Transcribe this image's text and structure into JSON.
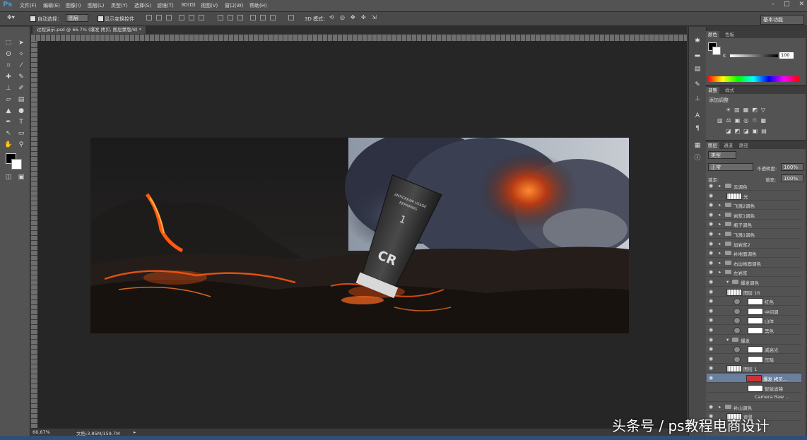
{
  "app": {
    "logo": "Ps"
  },
  "menu": [
    "文件(F)",
    "编辑(E)",
    "图像(I)",
    "图层(L)",
    "类型(Y)",
    "选择(S)",
    "滤镜(T)",
    "3D(D)",
    "视图(V)",
    "窗口(W)",
    "帮助(H)"
  ],
  "options": {
    "auto_select_label": "自动选择：",
    "auto_select_value": "图层",
    "show_transform_label": "显示变换控件",
    "mode_3d_label": "3D 模式："
  },
  "workspace": "基本功能",
  "document": {
    "tab_title": "过程演示.psd @ 66.7% (爆发 拷贝, 图层蒙版/8) *",
    "zoom": "66.67%",
    "doc_size": "文档:3.85M/159.7M"
  },
  "color_panel": {
    "tabs": [
      "颜色",
      "色板"
    ],
    "channel": "K",
    "value": "100"
  },
  "adjust_panel": {
    "tabs": [
      "调整",
      "样式"
    ],
    "title": "添加调整"
  },
  "layers_panel": {
    "tabs": [
      "图层",
      "通道",
      "路径"
    ],
    "filter": "类型",
    "blend_mode": "正常",
    "opacity_label": "不透明度:",
    "opacity": "100%",
    "lock_label": "锁定:",
    "fill_label": "填充:",
    "fill": "100%",
    "layers": [
      {
        "name": "云调色",
        "kind": "group"
      },
      {
        "name": "光",
        "kind": "layer"
      },
      {
        "name": "飞溅2调色",
        "kind": "group"
      },
      {
        "name": "岩浆1调色",
        "kind": "group"
      },
      {
        "name": "瓶子调色",
        "kind": "group"
      },
      {
        "name": "飞溅1调色",
        "kind": "group"
      },
      {
        "name": "加岩浆2",
        "kind": "group"
      },
      {
        "name": "补地面调色",
        "kind": "group"
      },
      {
        "name": "右边地面调色",
        "kind": "group"
      },
      {
        "name": "左岩浆",
        "kind": "group"
      },
      {
        "name": "爆发调色",
        "kind": "group-open"
      },
      {
        "name": "图层 16",
        "kind": "layer"
      },
      {
        "name": "红色",
        "kind": "adjust"
      },
      {
        "name": "中间调",
        "kind": "adjust"
      },
      {
        "name": "山体",
        "kind": "adjust"
      },
      {
        "name": "黑色",
        "kind": "adjust"
      },
      {
        "name": "爆发",
        "kind": "group-open"
      },
      {
        "name": "减高光",
        "kind": "adjust"
      },
      {
        "name": "压暗",
        "kind": "adjust"
      },
      {
        "name": "图层 1",
        "kind": "layer"
      },
      {
        "name": "爆发 拷贝...",
        "kind": "smart",
        "selected": true
      },
      {
        "name": "智能滤镜",
        "kind": "filter"
      },
      {
        "name": "Camera Raw ...",
        "kind": "filter"
      },
      {
        "name": "补山调色",
        "kind": "group"
      },
      {
        "name": "背景",
        "kind": "layer"
      }
    ]
  },
  "artwork": {
    "tube_brand": "CR",
    "tube_text1": "ANTICREAM USAGE",
    "tube_text2": "REPAIRING",
    "tube_num": "1"
  },
  "watermark": "头条号 / ps教程电商设计",
  "colors": {
    "lava": "#ff5a10",
    "selection": "#6a7f9e",
    "accent_blue": "#4a9bd8"
  }
}
